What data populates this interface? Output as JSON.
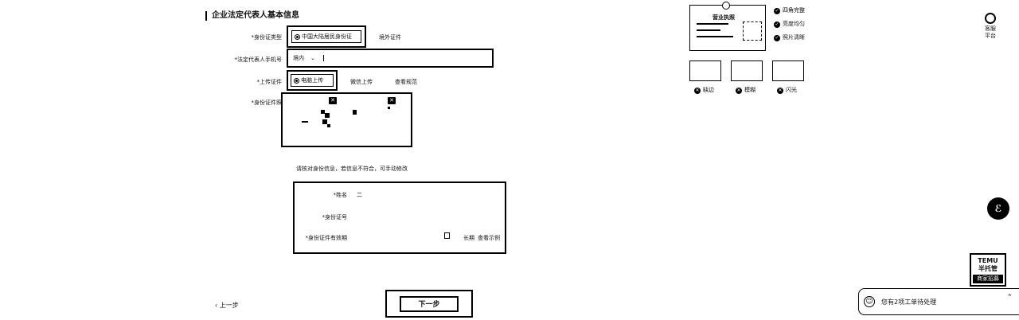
{
  "section": {
    "title": "企业法定代表人基本信息"
  },
  "id_type": {
    "label": "*身份证类型",
    "selected": "中国大陆居民身份证",
    "other_option": "境外证件"
  },
  "phone": {
    "label": "*法定代表人手机号",
    "region": "境内",
    "value": ""
  },
  "upload": {
    "label": "*上传证件",
    "selected": "电脑上传",
    "option_wechat": "微信上传",
    "link_spec": "查看规范"
  },
  "id_photos": {
    "label": "*身份证件照"
  },
  "verify_note": "请核对身份信息，若信息不符合，可手动修改",
  "form": {
    "name_label": "*姓名",
    "name_value": "二",
    "id_number_label": "*身份证号",
    "id_number_value": "",
    "validity_label": "*身份证件有效期",
    "long_term": "长期",
    "view_example": "查看示例"
  },
  "nav": {
    "prev": "上一步",
    "next": "下一步"
  },
  "sample": {
    "license_title": "营业执照",
    "checks": [
      "四角完整",
      "亮度均匀",
      "照片清晰"
    ],
    "bad_labels": [
      "缺边",
      "模糊",
      "闪光"
    ]
  },
  "side": {
    "service_label": "客服\n平台",
    "promo_line1": "TEMU",
    "promo_line2": "半托管",
    "promo_line3": "商家招募"
  },
  "chat": {
    "message": "您有2项工单待处理"
  }
}
